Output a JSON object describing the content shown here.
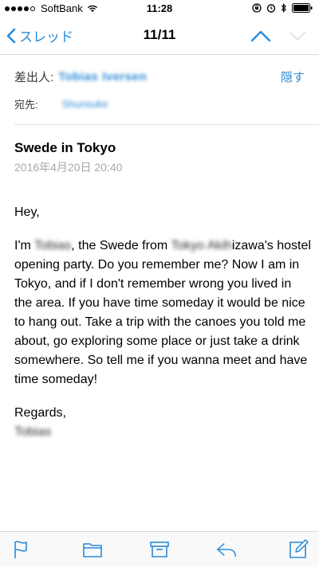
{
  "status_bar": {
    "carrier": "SoftBank",
    "time": "11:28"
  },
  "nav": {
    "back_label": "スレッド",
    "title": "11/11"
  },
  "header": {
    "from_label": "差出人:",
    "from_name": "Tobias Iversen",
    "hide_label": "隠す",
    "to_label": "宛先:",
    "to_name": "Shunsuke"
  },
  "message": {
    "subject": "Swede in Tokyo",
    "date": "2016年4月20日 20:40",
    "greeting": "Hey,",
    "body_p1_a": "I'm ",
    "body_p1_name": "Tobias",
    "body_p1_b": ", the Swede from ",
    "body_p1_place": "Tokyo Akih",
    "body_p1_c": "izawa's hostel opening party. Do you remember me? Now I am in Tokyo, and if I don't remember wrong you lived in the area. If you have time someday it would be nice to hang out. Take a trip with the canoes you told me about, go exploring some place or just take a drink somewhere. So tell me if you wanna meet and have time someday!",
    "closing": "Regards,",
    "signature": "Tobias"
  },
  "colors": {
    "accent": "#2a8bd8",
    "date_gray": "#a9a9a9"
  },
  "icons": {
    "flag": "flag-icon",
    "folder": "folder-icon",
    "archive": "archive-icon",
    "reply": "reply-icon",
    "compose": "compose-icon"
  }
}
